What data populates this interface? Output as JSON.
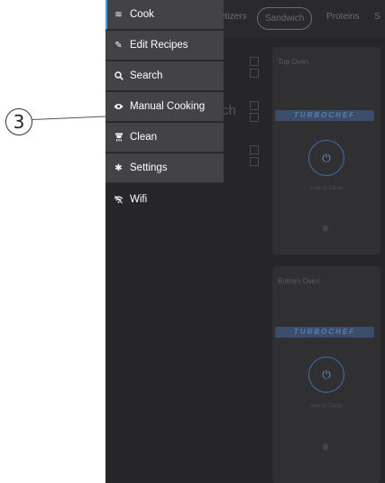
{
  "callout": {
    "number": "3"
  },
  "background": {
    "categories": [
      "etizers",
      "Sandwich",
      "Proteins",
      "S"
    ],
    "recipe_fragment": "ch",
    "ovens": [
      {
        "label": "Top Oven",
        "brand": "TURBOCHEF",
        "status": "Safe to Clean"
      },
      {
        "label": "Bottom Oven",
        "brand": "TURBOCHEF",
        "status": "Safe to Clean"
      }
    ]
  },
  "menu": {
    "items": [
      {
        "label": "Cook",
        "icon": "cook-icon",
        "active": true
      },
      {
        "label": "Edit Recipes",
        "icon": "pencil-icon"
      },
      {
        "label": "Search",
        "icon": "search-icon"
      },
      {
        "label": "Manual Cooking",
        "icon": "eye-icon"
      },
      {
        "label": "Clean",
        "icon": "clean-icon"
      },
      {
        "label": "Settings",
        "icon": "gear-icon"
      },
      {
        "label": "Wifi",
        "icon": "wifi-off-icon"
      }
    ]
  },
  "colors": {
    "accent": "#4da0e0",
    "drawer": "#262629",
    "menu_item": "#434347"
  }
}
